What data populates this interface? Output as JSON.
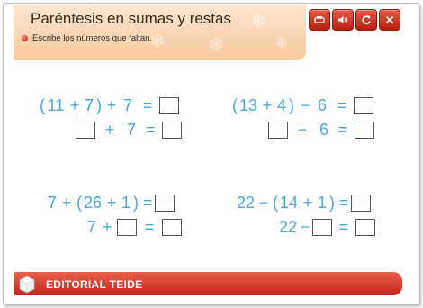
{
  "header": {
    "title": "Paréntesis en sumas y restas",
    "subtitle": "Escribe los números que faltan."
  },
  "toolbar": [
    {
      "name": "print-button",
      "icon": "printer-icon",
      "glyph": "⎙"
    },
    {
      "name": "audio-button",
      "icon": "speaker-icon",
      "glyph": "🔈"
    },
    {
      "name": "reload-button",
      "icon": "reload-icon",
      "glyph": "↻"
    },
    {
      "name": "close-button",
      "icon": "close-icon",
      "glyph": "✕"
    }
  ],
  "exercises": {
    "ex1": {
      "line1": {
        "open": "(",
        "a": "11",
        "plus": "+",
        "b": "7",
        "close": ")",
        "op": "+",
        "c": "7",
        "eq": "="
      },
      "line2": {
        "op": "+",
        "c": "7",
        "eq": "="
      }
    },
    "ex2": {
      "line1": {
        "open": "(",
        "a": "13",
        "plus": "+",
        "b": "4",
        "close": ")",
        "op": "−",
        "c": "6",
        "eq": "="
      },
      "line2": {
        "op": "−",
        "c": "6",
        "eq": "="
      }
    },
    "ex3": {
      "line1": {
        "a": "7",
        "plus": "+",
        "open": "(",
        "b": "26",
        "plus2": "+",
        "c": "1",
        "close": ")",
        "eq": "="
      },
      "line2": {
        "a": "7",
        "plus": "+",
        "eq": "="
      }
    },
    "ex4": {
      "line1": {
        "a": "22",
        "minus": "−",
        "open": "(",
        "b": "14",
        "plus": "+",
        "c": "1",
        "close": ")",
        "eq": "="
      },
      "line2": {
        "a": "22",
        "minus": "−",
        "eq": "="
      }
    }
  },
  "footer": {
    "brand": "EDITORIAL TEIDE"
  },
  "colors": {
    "accent": "#c4261a",
    "math_text": "#4aa7d6",
    "header_bg": "#f9c99d"
  }
}
